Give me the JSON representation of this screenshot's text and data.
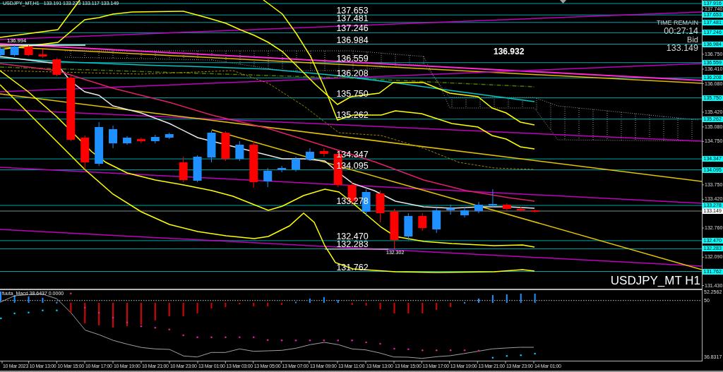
{
  "chart": {
    "symbol": "USDJPY_MT,H1",
    "ohlc": "133.191 133.223 133.117 133.149",
    "level_labels": [
      "137.653",
      "137.481",
      "137.246",
      "136.984",
      "136.559",
      "136.208",
      "135.750",
      "135.262",
      "134.347",
      "134.095",
      "133.278",
      "132.470",
      "132.283",
      "131.762"
    ],
    "marker_price": "136.994",
    "current_price": "136.932",
    "low_price": "132.302",
    "symbol_caption": "USDJPY_MT H1"
  },
  "timer": {
    "time_remain_label": "TIME REMAIN",
    "time_remain": "00:27:14",
    "bid_label": "Bid",
    "bid": "133.149"
  },
  "price_axis": {
    "tags": [
      {
        "text": "137.916",
        "kind": "level"
      },
      {
        "text": "137.653",
        "kind": "level"
      },
      {
        "text": "137.481",
        "kind": "level"
      },
      {
        "text": "137.246",
        "kind": "level"
      },
      {
        "text": "136.984",
        "kind": "level"
      },
      {
        "text": "136.559",
        "kind": "level"
      },
      {
        "text": "136.208",
        "kind": "level"
      },
      {
        "text": "135.750",
        "kind": "level"
      },
      {
        "text": "135.262",
        "kind": "level"
      },
      {
        "text": "134.347",
        "kind": "level"
      },
      {
        "text": "134.095",
        "kind": "level"
      },
      {
        "text": "133.278",
        "kind": "level"
      },
      {
        "text": "133.149",
        "kind": "bid"
      },
      {
        "text": "132.470",
        "kind": "level"
      },
      {
        "text": "132.283",
        "kind": "level"
      },
      {
        "text": "131.762",
        "kind": "level"
      }
    ],
    "ticks": [
      "137.740",
      "136.750",
      "136.410",
      "136.080",
      "135.420",
      "135.080",
      "134.750",
      "133.750",
      "133.420",
      "132.760",
      "132.090",
      "131.430"
    ]
  },
  "indicator": {
    "title": "fuuta_Macd 38.6437 0.0000",
    "axis_labels": [
      "52.2562",
      "50",
      "36.8317"
    ]
  },
  "time_axis": {
    "labels": [
      "10 Mar 2023",
      "10 Mar 13:00",
      "10 Mar 15:00",
      "10 Mar 17:00",
      "10 Mar 19:00",
      "10 Mar 21:00",
      "10 Mar 23:00",
      "13 Mar 01:00",
      "13 Mar 03:00",
      "13 Mar 05:00",
      "13 Mar 07:00",
      "13 Mar 09:00",
      "13 Mar 11:00",
      "13 Mar 13:00",
      "13 Mar 15:00",
      "13 Mar 17:00",
      "13 Mar 19:00",
      "13 Mar 21:00",
      "13 Mar 23:00",
      "14 Mar 01:00"
    ]
  }
}
